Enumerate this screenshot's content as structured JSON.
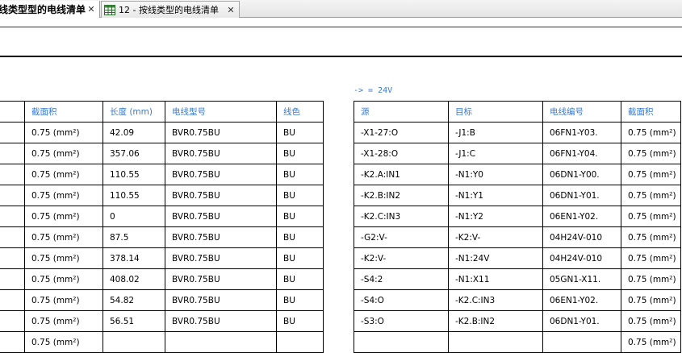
{
  "tabs": [
    {
      "label": "线类型型的电线清单",
      "active": true,
      "close": "✕"
    },
    {
      "label": "12 - 按线类型的电线清单",
      "active": false,
      "close": "✕"
    }
  ],
  "filter_label": "-> = 24V",
  "left_table": {
    "headers": [
      "",
      "截面积",
      "长度 (mm)",
      "电线型号",
      "线色"
    ],
    "rows": [
      [
        "",
        "0.75 (mm²)",
        "42.09",
        "BVR0.75BU",
        "BU"
      ],
      [
        "",
        "0.75 (mm²)",
        "357.06",
        "BVR0.75BU",
        "BU"
      ],
      [
        "",
        "0.75 (mm²)",
        "110.55",
        "BVR0.75BU",
        "BU"
      ],
      [
        "",
        "0.75 (mm²)",
        "110.55",
        "BVR0.75BU",
        "BU"
      ],
      [
        "",
        "0.75 (mm²)",
        "0",
        "BVR0.75BU",
        "BU"
      ],
      [
        "",
        "0.75 (mm²)",
        "87.5",
        "BVR0.75BU",
        "BU"
      ],
      [
        "",
        "0.75 (mm²)",
        "378.14",
        "BVR0.75BU",
        "BU"
      ],
      [
        "",
        "0.75 (mm²)",
        "408.02",
        "BVR0.75BU",
        "BU"
      ],
      [
        "",
        "0.75 (mm²)",
        "54.82",
        "BVR0.75BU",
        "BU"
      ],
      [
        "",
        "0.75 (mm²)",
        "56.51",
        "BVR0.75BU",
        "BU"
      ],
      [
        "",
        "0.75 (mm²)",
        "",
        "",
        ""
      ]
    ]
  },
  "right_table": {
    "headers": [
      "源",
      "目标",
      "电线编号",
      "截面积"
    ],
    "rows": [
      [
        "-X1-27:O",
        "-J1:B",
        "06FN1-Y03.",
        "0.75 (mm²)"
      ],
      [
        "-X1-28:O",
        "-J1:C",
        "06FN1-Y04.",
        "0.75 (mm²)"
      ],
      [
        "-K2.A:IN1",
        "-N1:Y0",
        "06DN1-Y00.",
        "0.75 (mm²)"
      ],
      [
        "-K2.B:IN2",
        "-N1:Y1",
        "06DN1-Y01.",
        "0.75 (mm²)"
      ],
      [
        "-K2.C:IN3",
        "-N1:Y2",
        "06EN1-Y02.",
        "0.75 (mm²)"
      ],
      [
        "-G2:V-",
        "-K2:V-",
        "04H24V-010",
        "0.75 (mm²)"
      ],
      [
        "-K2:V-",
        "-N1:24V",
        "04H24V-010",
        "0.75 (mm²)"
      ],
      [
        "-S4:2",
        "-N1:X11",
        "05GN1-X11.",
        "0.75 (mm²)"
      ],
      [
        "-S4:O",
        "-K2.C:IN3",
        "06EN1-Y02.",
        "0.75 (mm²)"
      ],
      [
        "-S3:O",
        "-K2.B:IN2",
        "06DN1-Y01.",
        "0.75 (mm²)"
      ],
      [
        "",
        "",
        "",
        "0.75 (mm²)"
      ]
    ]
  }
}
